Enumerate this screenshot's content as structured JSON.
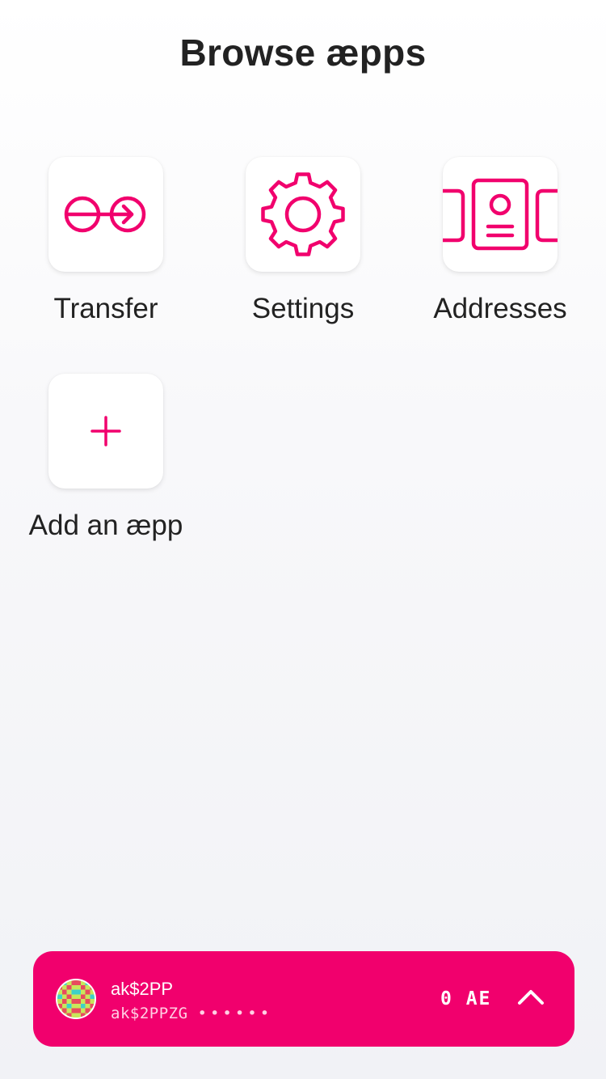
{
  "header": {
    "title": "Browse æpps"
  },
  "apps": [
    {
      "label": "Transfer",
      "icon": "transfer-icon"
    },
    {
      "label": "Settings",
      "icon": "gear-icon"
    },
    {
      "label": "Addresses",
      "icon": "address-book-icon"
    },
    {
      "label": "Add an æpp",
      "icon": "plus-icon"
    }
  ],
  "account": {
    "name": "ak$2PP",
    "address": "ak$2PPZG",
    "address_mask": "••••••",
    "balance": "0 AE",
    "avatar_icon": "identicon-avatar",
    "expand_icon": "chevron-up-icon"
  },
  "colors": {
    "accent": "#f1006d",
    "background": "#f4f5f8",
    "tile": "#ffffff",
    "text": "#222222"
  }
}
